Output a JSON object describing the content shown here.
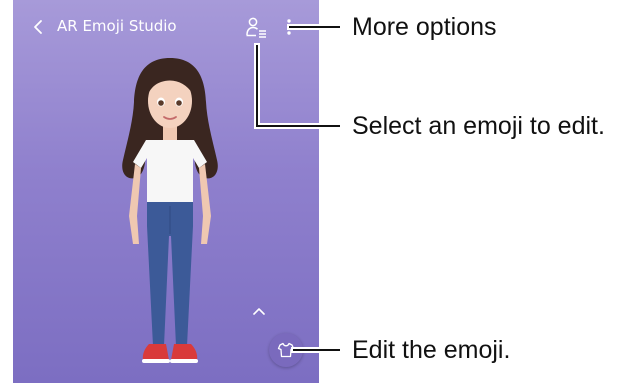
{
  "app": {
    "title": "AR Emoji Studio",
    "accent_color": "#8f80cd",
    "icons": {
      "back": "chevron-left-icon",
      "select_emoji": "person-list-icon",
      "more_options": "vertical-dots-icon",
      "expand": "chevron-up-icon",
      "edit": "t-shirt-icon"
    }
  },
  "callouts": {
    "more_options": "More options",
    "select_emoji": "Select an emoji to edit.",
    "edit_emoji": "Edit the emoji."
  }
}
